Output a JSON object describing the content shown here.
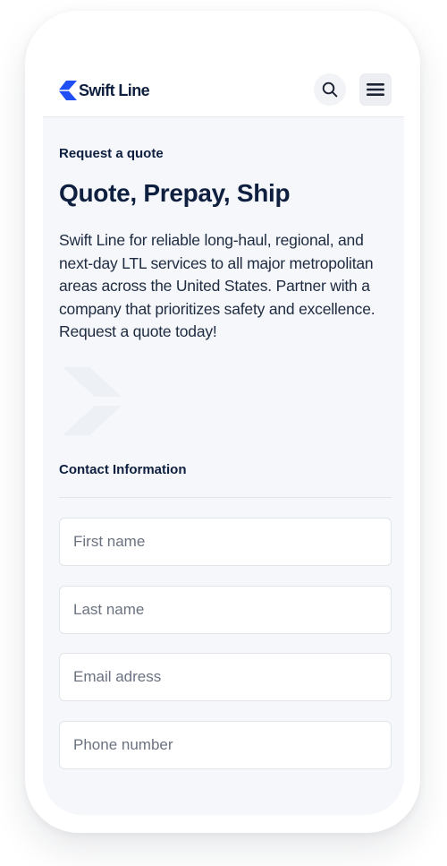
{
  "header": {
    "logo_text": "Swift Line",
    "brand_color": "#1f4ff5",
    "search_icon": "search-icon",
    "menu_icon": "hamburger-menu-icon"
  },
  "hero": {
    "eyebrow": "Request a quote",
    "title": "Quote, Prepay, Ship",
    "description": "Swift Line for reliable long-haul, regional, and next-day LTL services to all major metropolitan areas across the United States. Partner with a company that prioritizes safety and excellence. Request a quote today!"
  },
  "form": {
    "section_label": "Contact Information",
    "fields": [
      {
        "placeholder": "First name",
        "value": ""
      },
      {
        "placeholder": "Last name",
        "value": ""
      },
      {
        "placeholder": "Email adress",
        "value": ""
      },
      {
        "placeholder": "Phone number",
        "value": ""
      }
    ]
  }
}
